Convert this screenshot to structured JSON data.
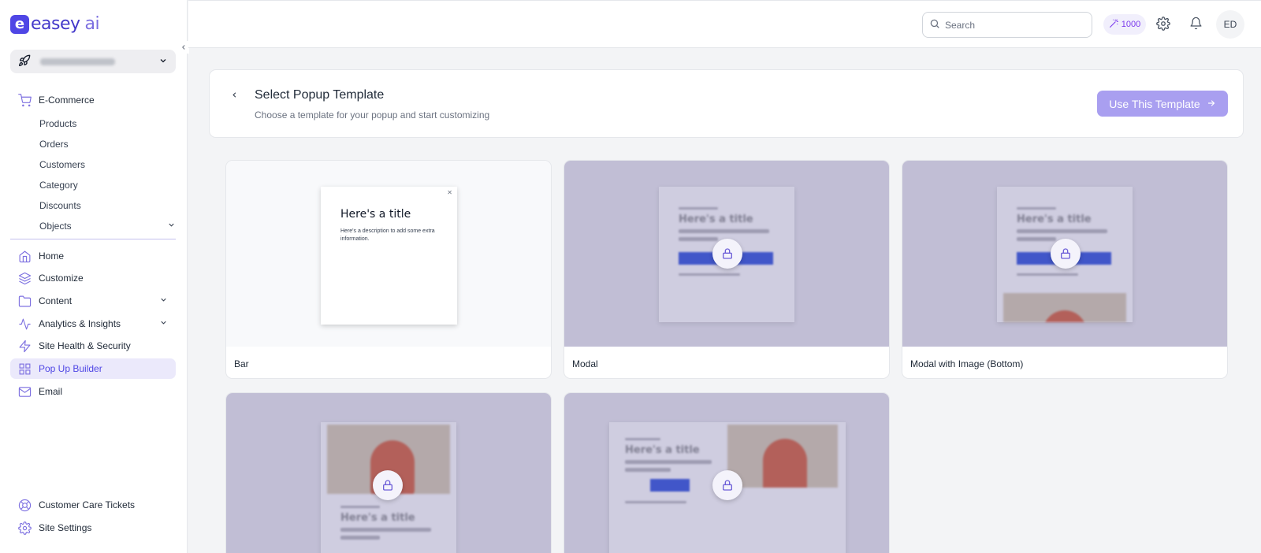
{
  "app": {
    "logo_text": "easey",
    "logo_suffix": "ai",
    "logo_letter": "e"
  },
  "site_selector": {
    "value": "(blurred site name)"
  },
  "sidebar": {
    "ecommerce": {
      "label": "E-Commerce",
      "icon": "cart-icon"
    },
    "ecommerce_items": [
      "Products",
      "Orders",
      "Customers",
      "Category",
      "Discounts",
      "Objects"
    ],
    "nav": [
      {
        "label": "Home",
        "icon": "home-icon"
      },
      {
        "label": "Customize",
        "icon": "layers-icon"
      },
      {
        "label": "Content",
        "icon": "folder-icon"
      },
      {
        "label": "Analytics & Insights",
        "icon": "activity-icon"
      },
      {
        "label": "Site Health & Security",
        "icon": "bolt-icon"
      },
      {
        "label": "Pop Up Builder",
        "icon": "grid-icon",
        "active": true
      },
      {
        "label": "Email",
        "icon": "mail-icon"
      }
    ],
    "footer": [
      {
        "label": "Customer Care Tickets",
        "icon": "lifebuoy-icon"
      },
      {
        "label": "Site Settings",
        "icon": "gear-icon"
      }
    ]
  },
  "topbar": {
    "search_placeholder": "Search",
    "credits": "1000",
    "avatar_initials": "ED"
  },
  "header": {
    "title": "Select Popup Template",
    "subtitle": "Choose a template for your popup and start customizing",
    "use_button": "Use This Template"
  },
  "templates": [
    {
      "name": "Bar",
      "locked": false,
      "preview_title": "Here's a title",
      "preview_desc": "Here's a description to add some extra information."
    },
    {
      "name": "Modal",
      "locked": true
    },
    {
      "name": "Modal with Image (Bottom)",
      "locked": true
    },
    {
      "name": "",
      "locked": true
    },
    {
      "name": "",
      "locked": true
    }
  ],
  "colors": {
    "accent": "#4f46e5",
    "accent_light": "#a99ff0",
    "active_bg": "#ebe9fb",
    "locked_overlay": "#c1bed5"
  }
}
